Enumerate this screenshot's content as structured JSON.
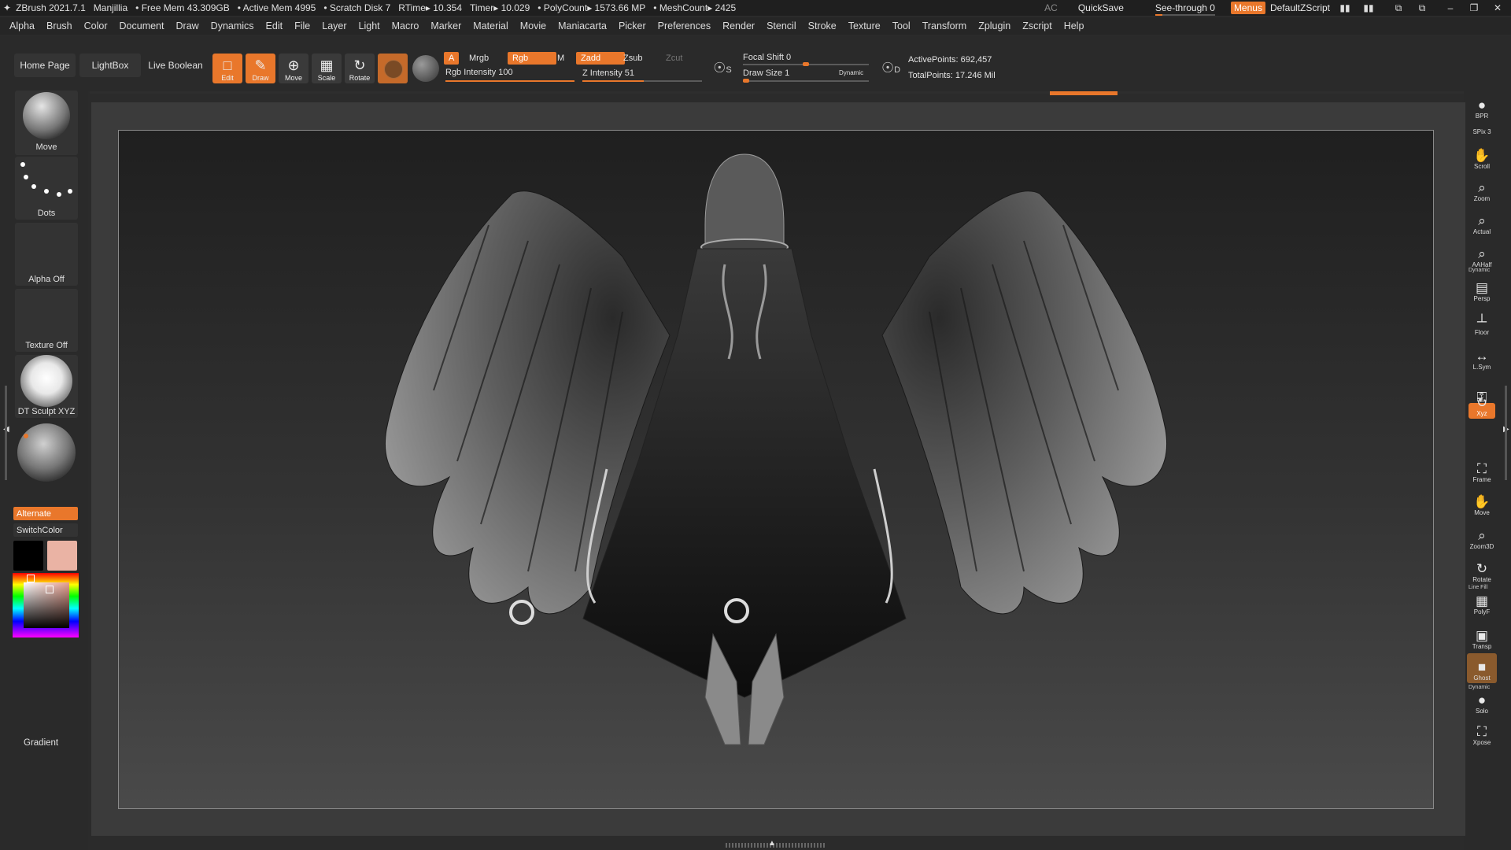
{
  "titlebar": {
    "app": "ZBrush 2021.7.1",
    "user": "Manjillia",
    "free_mem": "Free Mem 43.309GB",
    "active_mem": "Active Mem 4995",
    "scratch_disk": "Scratch Disk 7",
    "rtime": "RTime▸ 10.354",
    "timer": "Timer▸ 10.029",
    "polycount": "PolyCount▸ 1573.66 MP",
    "meshcount": "MeshCount▸ 2425",
    "ac": "AC",
    "quicksave": "QuickSave",
    "see_through": "See-through   0",
    "see_through_level": 0,
    "menus": "Menus",
    "default_zscript": "DefaultZScript"
  },
  "menubar": [
    "Alpha",
    "Brush",
    "Color",
    "Document",
    "Draw",
    "Dynamics",
    "Edit",
    "File",
    "Layer",
    "Light",
    "Macro",
    "Marker",
    "Material",
    "Movie",
    "Maniacarta",
    "Picker",
    "Preferences",
    "Render",
    "Stencil",
    "Stroke",
    "Texture",
    "Tool",
    "Transform",
    "Zplugin",
    "Zscript",
    "Help"
  ],
  "toolbar": {
    "home_page": "Home Page",
    "lightbox": "LightBox",
    "live_boolean": "Live Boolean",
    "edit": "Edit",
    "draw": "Draw",
    "move": "Move",
    "scale": "Scale",
    "rotate": "Rotate",
    "a_btn": "A",
    "mrgb": "Mrgb",
    "rgb": "Rgb",
    "m": "M",
    "zadd": "Zadd",
    "zsub": "Zsub",
    "zcut": "Zcut",
    "rgb_intensity": "Rgb Intensity 100",
    "rgb_intensity_value": 100,
    "z_intensity": "Z Intensity 51",
    "z_intensity_value": 51,
    "focal_shift": "Focal Shift 0",
    "draw_size": "Draw Size 1",
    "dynamic": "Dynamic",
    "s_label": "S",
    "d_label": "D",
    "active_points": "ActivePoints: 692,457",
    "total_points": "TotalPoints: 17.246 Mil"
  },
  "left_shelf": {
    "brush": "Move",
    "stroke": "Dots",
    "alpha": "Alpha Off",
    "texture": "Texture Off",
    "material": "DT Sculpt XYZ",
    "alternate": "Alternate",
    "switch_color": "SwitchColor",
    "gradient": "Gradient",
    "main_color": "#000000",
    "secondary_color": "#eab3a4"
  },
  "right_shelf": [
    {
      "name": "bpr",
      "label": "BPR",
      "icon": "●"
    },
    {
      "name": "spix",
      "label": "SPix 3",
      "icon": ""
    },
    {
      "name": "scroll",
      "label": "Scroll",
      "icon": "✋"
    },
    {
      "name": "zoom",
      "label": "Zoom",
      "icon": "⌕"
    },
    {
      "name": "actual",
      "label": "Actual",
      "icon": "⌕"
    },
    {
      "name": "aahalf",
      "label": "AAHalf",
      "icon": "⌕"
    },
    {
      "name": "persp",
      "label": "Persp",
      "icon": "▤"
    },
    {
      "name": "floor",
      "label": "Floor",
      "icon": "┴"
    },
    {
      "name": "lsym",
      "label": "L.Sym",
      "icon": "↔"
    },
    {
      "name": "lock",
      "label": "",
      "icon": "⚿"
    },
    {
      "name": "xyz",
      "label": "Xyz",
      "icon": "↻"
    },
    {
      "name": "frame",
      "label": "Frame",
      "icon": "⛶"
    },
    {
      "name": "move",
      "label": "Move",
      "icon": "✋"
    },
    {
      "name": "zoom3d",
      "label": "Zoom3D",
      "icon": "⌕"
    },
    {
      "name": "rotate",
      "label": "Rotate",
      "icon": "↻"
    },
    {
      "name": "polyf",
      "label": "PolyF",
      "icon": "▦"
    },
    {
      "name": "transp",
      "label": "Transp",
      "icon": "▣"
    },
    {
      "name": "ghost",
      "label": "Ghost",
      "icon": "■"
    },
    {
      "name": "solo",
      "label": "Solo",
      "icon": "●"
    },
    {
      "name": "xpose",
      "label": "Xpose",
      "icon": "⛶"
    }
  ],
  "right_shelf_extra": {
    "dynamic": "Dynamic",
    "line_fill": "Line Fill",
    "dynamic2": "Dynamic"
  }
}
